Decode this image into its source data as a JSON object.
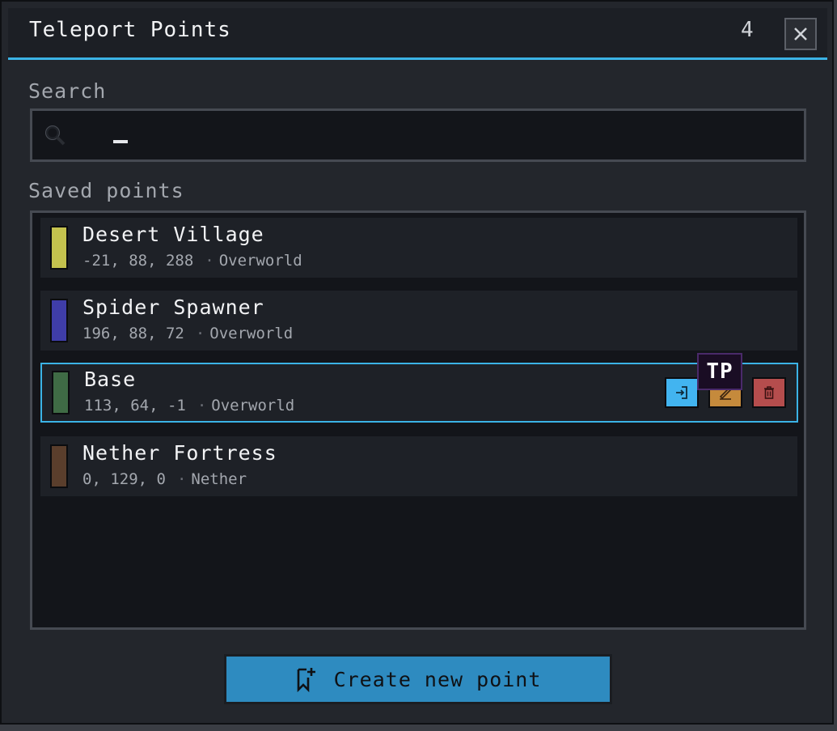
{
  "window": {
    "title": "Teleport Points",
    "count": "4",
    "close_icon": "close-icon"
  },
  "search": {
    "label": "Search",
    "value": "",
    "placeholder": "",
    "icon": "search-icon"
  },
  "list": {
    "label": "Saved points",
    "points": [
      {
        "name": "Desert Village",
        "coords": "-21, 88, 288",
        "dimension": "Overworld",
        "color": "#c4c24e"
      },
      {
        "name": "Spider Spawner",
        "coords": "196, 88, 72",
        "dimension": "Overworld",
        "color": "#3f3da8"
      },
      {
        "name": "Base",
        "coords": "113, 64, -1",
        "dimension": "Overworld",
        "color": "#3f6b45",
        "selected": true
      },
      {
        "name": "Nether Fortress",
        "coords": "0, 129, 0",
        "dimension": "Nether",
        "color": "#5a3e2c"
      }
    ],
    "actions": {
      "teleport_icon": "teleport-icon",
      "edit_icon": "edit-icon",
      "delete_icon": "trash-icon",
      "teleport_color": "#42b4f0",
      "edit_color": "#c58a3c",
      "delete_color": "#b54d4d"
    },
    "tooltip": "TP"
  },
  "footer": {
    "create_label": "Create new point",
    "create_icon": "bookmark-add-icon",
    "button_color": "#2e8bc0"
  },
  "accent": "#3bb3e6"
}
